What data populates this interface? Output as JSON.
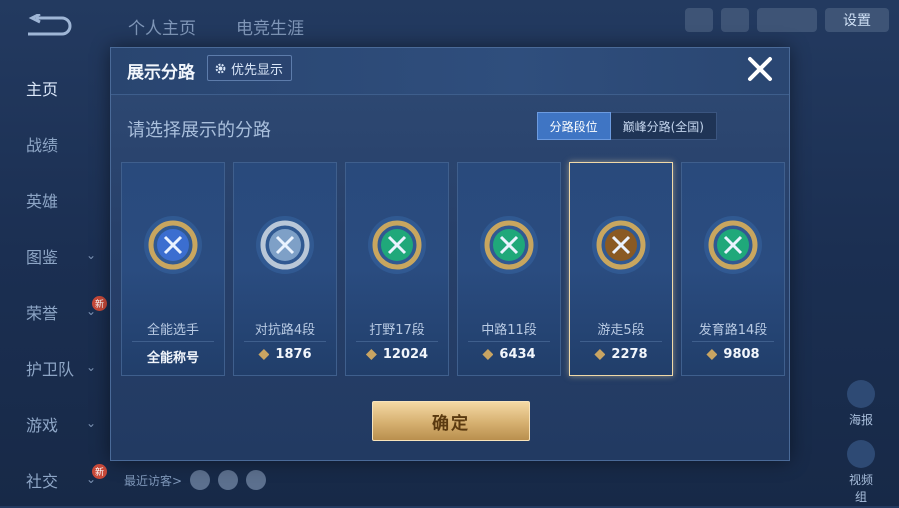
{
  "top_tabs": [
    "个人主页",
    "电竞生涯"
  ],
  "settings_label": "设置",
  "side_nav": [
    {
      "label": "主页",
      "active": true,
      "chevron": false,
      "new": false
    },
    {
      "label": "战绩",
      "active": false,
      "chevron": false,
      "new": false
    },
    {
      "label": "英雄",
      "active": false,
      "chevron": false,
      "new": false
    },
    {
      "label": "图鉴",
      "active": false,
      "chevron": true,
      "new": false
    },
    {
      "label": "荣誉",
      "active": false,
      "chevron": true,
      "new": true
    },
    {
      "label": "护卫队",
      "active": false,
      "chevron": true,
      "new": false
    },
    {
      "label": "游戏",
      "active": false,
      "chevron": true,
      "new": false
    },
    {
      "label": "社交",
      "active": false,
      "chevron": true,
      "new": true
    }
  ],
  "new_badge": "新",
  "recent_visitors": "最近访客>",
  "right_buttons": [
    "海报",
    "视频组"
  ],
  "modal": {
    "title": "展示分路",
    "priority_label": "优先显示",
    "subtitle": "请选择展示的分路",
    "segments": [
      "分路段位",
      "巅峰分路(全国)"
    ],
    "confirm_label": "确定",
    "cards": [
      {
        "name": "全能选手",
        "score": "全能称号",
        "points": false,
        "selected": false,
        "color": "#c8a65f",
        "core": "#3b6ed0"
      },
      {
        "name": "对抗路4段",
        "score": "1876",
        "points": true,
        "selected": false,
        "color": "#b9c7d8",
        "core": "#7ea0c7"
      },
      {
        "name": "打野17段",
        "score": "12024",
        "points": true,
        "selected": false,
        "color": "#c8a65f",
        "core": "#1fa87a"
      },
      {
        "name": "中路11段",
        "score": "6434",
        "points": true,
        "selected": false,
        "color": "#c8a65f",
        "core": "#1fa87a"
      },
      {
        "name": "游走5段",
        "score": "2278",
        "points": true,
        "selected": true,
        "color": "#c8a65f",
        "core": "#8a5a23"
      },
      {
        "name": "发育路14段",
        "score": "9808",
        "points": true,
        "selected": false,
        "color": "#c8a65f",
        "core": "#1fa87a"
      }
    ]
  }
}
